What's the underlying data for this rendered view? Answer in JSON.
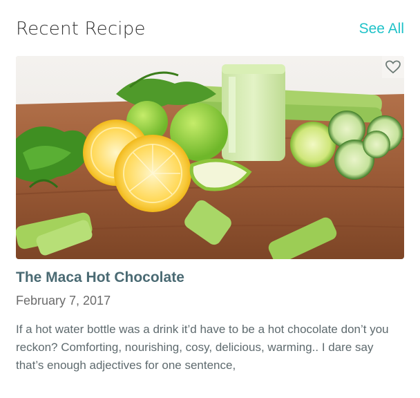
{
  "section": {
    "title": "Recent Recipe",
    "see_all_label": "See All",
    "accent_color": "#1fc2c8"
  },
  "recipe": {
    "image_alt": "green juice with lemons, celery, apples and cucumber on a wooden table",
    "favorite_icon": "heart-icon",
    "title": "The Maca Hot Chocolate",
    "date": "February 7, 2017",
    "excerpt": "If a hot water bottle was a drink it’d have to be a hot chocolate don’t you reckon? Comforting, nourishing, cosy, delicious, warming.. I dare say that’s enough adjectives for one sentence,"
  }
}
